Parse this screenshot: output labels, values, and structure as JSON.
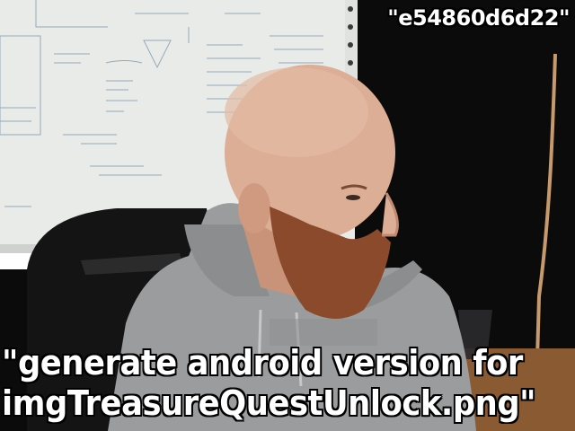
{
  "overlay": {
    "top_caption": "\"e54860d6d22\"",
    "bottom_caption_line1": "\"generate android version for",
    "bottom_caption_line2": "imgTreasureQuestUnlock.png\""
  },
  "colors": {
    "whiteboard": "#e9ebe8",
    "wall": "#0b0b0b",
    "hoodie": "#9a9c9e",
    "skin": "#d9a58a",
    "beard": "#8a4a2b",
    "table": "#8a5a33"
  }
}
